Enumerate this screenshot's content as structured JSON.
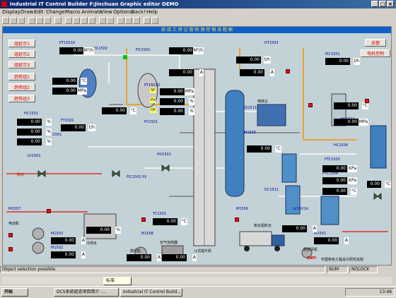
{
  "window": {
    "title": "Industrial IT Control Builder F:Jinchuan  Graphic editor  DEMO"
  },
  "menu": [
    "Display",
    "Draw",
    "Edit",
    "Change",
    "Macro",
    "Animate",
    "View",
    "Options",
    "Back!",
    "Help"
  ],
  "banner": "焙 烧 工 序 过 程 检 测 控 制 流 程 图",
  "left_buttons": [
    "组延示1",
    "组延示2",
    "组延示3",
    "趋势组1",
    "趋势组2",
    "趋势组3"
  ],
  "right_buttons": [
    "总貌",
    "电机控制"
  ],
  "tags": {
    "pt1501a": "PT1501A",
    "hc1502": "HC1502",
    "fic1501": "FIC1501",
    "ht1503": "HT1503",
    "pic1501": "PIC1501",
    "pt1501d": "PT1501D",
    "ft1501": "FT1501",
    "hc1501": "HC1501",
    "lv1501": "LV1501",
    "lv1502": "LV1502",
    "pv1501": "PV1501",
    "ss1511": "SS1511",
    "hc1511": "HC1511",
    "hv1501": "HV1501",
    "hc1504": "HC1504",
    "ptc1502": "PTC1502",
    "fic1501p": "FIC1501 PV",
    "m1505": "M1505",
    "dc1511": "DC1511",
    "tc1501": "TC1501",
    "ptc1504": "PTC1504",
    "m1503": "M1503",
    "m1502": "M1502",
    "m1508": "M1508",
    "m1501": "M1501",
    "lv1501a": "LV1501A",
    "m1507": "M1507",
    "m1506": "M1506"
  },
  "values": [
    {
      "v": "0.00",
      "u": "M³/h"
    },
    {
      "v": "0.00",
      "u": "M³/h"
    },
    {
      "v": "0.00",
      "u": "t/h"
    },
    {
      "v": "0.00",
      "u": "l/h"
    },
    {
      "v": "0.00",
      "u": "°C"
    },
    {
      "v": "0.00",
      "u": "MPa"
    },
    {
      "v": "0.00",
      "u": "A"
    },
    {
      "v": "0.00",
      "u": "A"
    },
    {
      "v": "0.00",
      "u": "°C"
    },
    {
      "v": "0.00",
      "u": "MPa"
    },
    {
      "v": "0.00",
      "u": "%"
    },
    {
      "v": "0.00",
      "u": "%"
    },
    {
      "v": "0.00",
      "u": "%"
    },
    {
      "v": "0.00",
      "u": "t/h"
    },
    {
      "v": "0.00",
      "u": "%"
    },
    {
      "v": "0.00",
      "u": "°C"
    },
    {
      "v": "0.00",
      "u": "°C"
    },
    {
      "v": "0.00",
      "u": "MPa"
    },
    {
      "v": "0.00",
      "u": "°C"
    },
    {
      "v": "0.00",
      "u": "KPa"
    },
    {
      "v": "0.00",
      "u": "KPa"
    },
    {
      "v": "0.00",
      "u": "°C"
    },
    {
      "v": "0.00",
      "u": "°C"
    },
    {
      "v": "0.00",
      "u": "%"
    },
    {
      "v": "0.00",
      "u": "A"
    },
    {
      "v": "0.00",
      "u": "A"
    },
    {
      "v": "0.00",
      "u": "A"
    },
    {
      "v": "0.00",
      "u": "A"
    },
    {
      "v": "0.00",
      "u": "A"
    },
    {
      "v": "0.00",
      "u": "A"
    },
    {
      "v": "0.00",
      "u": "%"
    }
  ],
  "labels": {
    "sp": "SP",
    "pv": "PV",
    "op": "OP",
    "tower": "斗式提升机",
    "fan1": "鼓风机",
    "fan2": "空气加热器",
    "dust": "电除尘",
    "feed": "氧化铝料仓",
    "company": "中国有色工程设计研究总院",
    "logo": "ENFI",
    "water": "软水",
    "aux": "助燃风机",
    "stir": "冷却水",
    "motor": "电动机"
  },
  "status": {
    "text": "Object selection possible.",
    "num": "NUM",
    "nolock": "NOLOCK"
  },
  "taskbar": {
    "start": "开始",
    "items": [
      "DCS系统组态项目简介 -...",
      "Industrial IT Control Build..."
    ],
    "ime": "标准",
    "clock": "13:48"
  }
}
